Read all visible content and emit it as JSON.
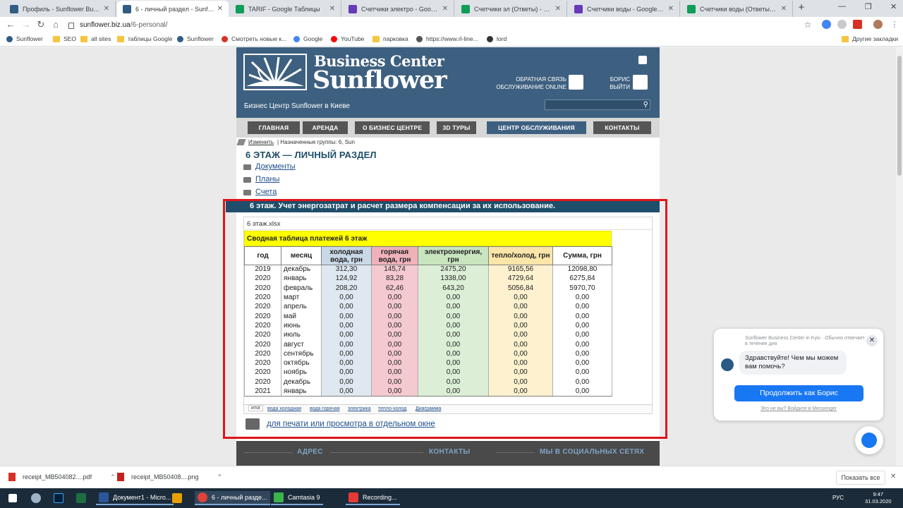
{
  "browser": {
    "tabs": [
      {
        "title": "Профиль - Sunflower Business C...",
        "color": "#2f5d86"
      },
      {
        "title": "6 - личный раздел - Sunflower B...",
        "color": "#2f5d86"
      },
      {
        "title": "TARIF - Google Таблицы",
        "color": "#0f9d58"
      },
      {
        "title": "Счетчики электро - Google Фор...",
        "color": "#673ab7"
      },
      {
        "title": "Счетчики эл (Ответы) - Google ...",
        "color": "#0f9d58"
      },
      {
        "title": "Счетчики воды - Google Формы",
        "color": "#673ab7"
      },
      {
        "title": "Счетчики воды (Ответы) - Goog...",
        "color": "#0f9d58"
      }
    ],
    "active_tab": 1,
    "url_host": "sunflower.biz.ua",
    "url_path": "/6-personal/",
    "bookmarks": [
      "Sunflower",
      "SEO",
      "all sites",
      "таблицы Google",
      "Sunflower",
      "Смотреть новые к...",
      "Google",
      "YouTube",
      "парковка",
      "https://www.rl-line...",
      "lord"
    ],
    "other_bookmarks": "Другие закладки"
  },
  "site": {
    "logo_line1": "Business Center",
    "logo_line2": "Sunflower",
    "tagline": "Бизнес Центр Sunflower в Киеве",
    "feedback_line1": "ОБРАТНАЯ СВЯЗЬ",
    "feedback_line2": "ОБСЛУЖИВАНИЕ ONLINE",
    "user_line1": "БОРИС",
    "user_line2": "ВЫЙТИ",
    "nav": [
      "ГЛАВНАЯ",
      "АРЕНДА",
      "О БИЗНЕС ЦЕНТРЕ",
      "3D ТУРЫ",
      "ЦЕНТР ОБСЛУЖИВАНИЯ",
      "КОНТАКТЫ"
    ],
    "nav_active": 4,
    "edit_label": "Изменить",
    "groups_label": "| Назначенные группы: 6, Sun",
    "page_title": "6 ЭТАЖ — ЛИЧНЫЙ РАЗДЕЛ",
    "doc_links": [
      "Документы",
      "Планы",
      "Счета"
    ],
    "section_heading": "6 этаж. Учет  энергозатрат и расчет размера компенсации за их использование.",
    "print_link": "для печати или просмотра в отдельном окне",
    "footer": [
      "АДРЕС",
      "КОНТАКТЫ",
      "МЫ В СОЦИАЛЬНЫХ СЕТЯХ"
    ]
  },
  "spreadsheet": {
    "file_name": "6 этаж.xlsx",
    "title": "Сводная таблица платежей 6 этаж",
    "columns": [
      "год",
      "месяц",
      "холодная вода, грн",
      "горячая вода, грн",
      "электроэнергия, грн",
      "тепло/холод, грн",
      "Сумма, грн"
    ],
    "rows": [
      [
        "2019",
        "декабрь",
        "312,30",
        "145,74",
        "2475,20",
        "9165,56",
        "12098,80"
      ],
      [
        "2020",
        "январь",
        "124,92",
        "83,28",
        "1338,00",
        "4729,64",
        "6275,84"
      ],
      [
        "2020",
        "февраль",
        "208,20",
        "62,46",
        "643,20",
        "5056,84",
        "5970,70"
      ],
      [
        "2020",
        "март",
        "0,00",
        "0,00",
        "0,00",
        "0,00",
        "0,00"
      ],
      [
        "2020",
        "апрель",
        "0,00",
        "0,00",
        "0,00",
        "0,00",
        "0,00"
      ],
      [
        "2020",
        "май",
        "0,00",
        "0,00",
        "0,00",
        "0,00",
        "0,00"
      ],
      [
        "2020",
        "июнь",
        "0,00",
        "0,00",
        "0,00",
        "0,00",
        "0,00"
      ],
      [
        "2020",
        "июль",
        "0,00",
        "0,00",
        "0,00",
        "0,00",
        "0,00"
      ],
      [
        "2020",
        "август",
        "0,00",
        "0,00",
        "0,00",
        "0,00",
        "0,00"
      ],
      [
        "2020",
        "сентябрь",
        "0,00",
        "0,00",
        "0,00",
        "0,00",
        "0,00"
      ],
      [
        "2020",
        "октябрь",
        "0,00",
        "0,00",
        "0,00",
        "0,00",
        "0,00"
      ],
      [
        "2020",
        "ноябрь",
        "0,00",
        "0,00",
        "0,00",
        "0,00",
        "0,00"
      ],
      [
        "2020",
        "декабрь",
        "0,00",
        "0,00",
        "0,00",
        "0,00",
        "0,00"
      ],
      [
        "2021",
        "январь",
        "0,00",
        "0,00",
        "0,00",
        "0,00",
        "0,00"
      ]
    ],
    "sheet_tabs": [
      "итог",
      "вода холодная",
      "вода горячая",
      "электрика",
      "тепло-холод",
      "Диаграмма"
    ],
    "active_sheet": 0
  },
  "messenger": {
    "header": "Sunflower Business Center in Kyiv · Обычно отвечает в течение дня",
    "greeting": "Здравствуйте! Чем мы можем вам помочь?",
    "cta": "Продолжить как Борис",
    "footer": "Это не вы? Войдите в Messenger"
  },
  "downloads": {
    "items": [
      "receipt_MB504082....pdf",
      "receipt_MB50408....png"
    ],
    "show_all": "Показать все"
  },
  "taskbar": {
    "apps": [
      "Документ1 - Micro...",
      "6 - личный разде...",
      "Camtasia 9",
      "Recording..."
    ],
    "lang": "РУС",
    "time": "9:47",
    "date": "31.03.2020"
  },
  "colors": {
    "site_header": "#3e6080",
    "highlight_box": "#e0151b",
    "messenger_blue": "#1877f2"
  }
}
